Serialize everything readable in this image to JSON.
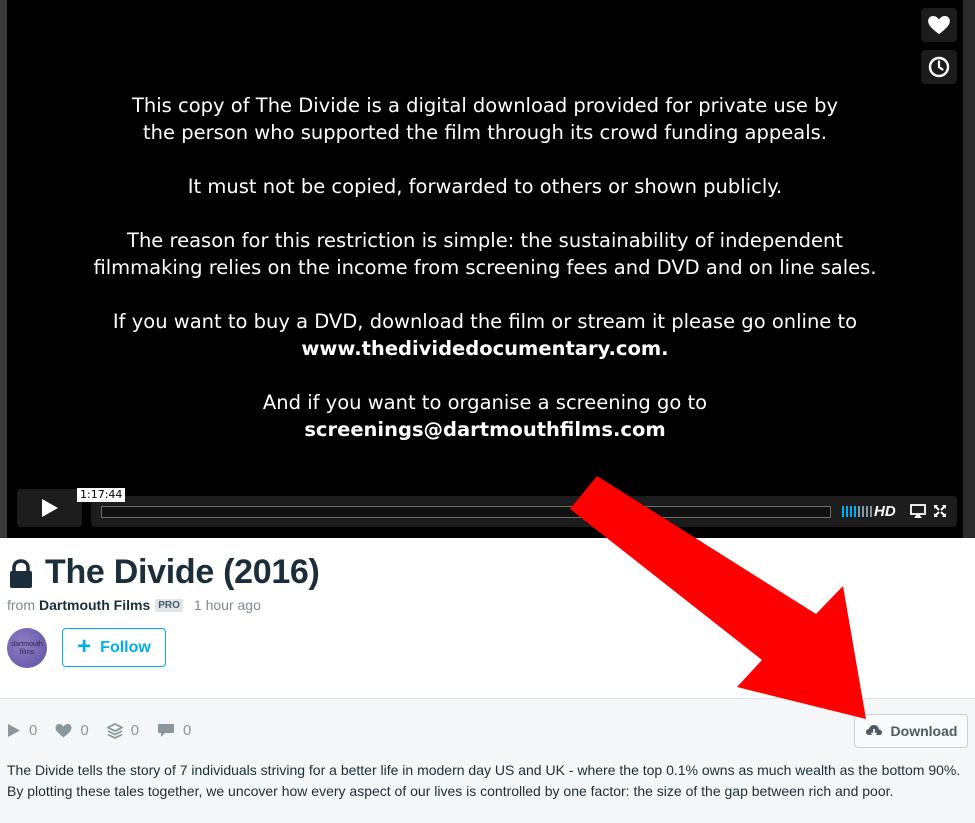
{
  "player": {
    "slate_lines": {
      "p1_l1": "This copy of The Divide is a digital download provided for private use by",
      "p1_l2": "the person who supported the film through its crowd funding appeals.",
      "p2": "It must not be copied, forwarded to others or shown publicly.",
      "p3_l1": "The reason for this restriction is simple: the sustainability of independent",
      "p3_l2": "filmmaking relies on the income from screening fees and DVD and on line sales.",
      "p4_l1": "If you want to buy a DVD, download the film or stream it please go online to",
      "p4_l2": "www.thedividedocumentary.com.",
      "p5_l1": "And if you want to organise a screening go to",
      "p5_l2": "screenings@dartmouthfilms.com"
    },
    "timecode": "1:17:44",
    "hd_label": "HD",
    "icons": {
      "like": "heart-icon",
      "watch_later": "clock-icon",
      "play": "play-icon",
      "volume": "volume-bars-icon",
      "airplay": "airplay-icon",
      "fullscreen": "fullscreen-icon"
    }
  },
  "video": {
    "title": "The Divide (2016)",
    "from_label": "from",
    "owner": "Dartmouth Films",
    "owner_badge": "PRO",
    "uploaded": "1 hour ago",
    "avatar_text": "dartmouth films",
    "follow_label": "Follow"
  },
  "stats": {
    "plays": "0",
    "likes": "0",
    "collections": "0",
    "comments": "0"
  },
  "download_label": "Download",
  "description": "The Divide tells the story of 7 individuals striving for a better life in modern day US and UK - where the top 0.1% owns as much wealth as the bottom 90%. By plotting these tales together, we uncover how every aspect of our lives is controlled by one factor: the size of the gap between rich and poor.",
  "colors": {
    "accent": "#00adef",
    "annotation_arrow": "#ff0000",
    "title_text": "#1a2e3b"
  }
}
